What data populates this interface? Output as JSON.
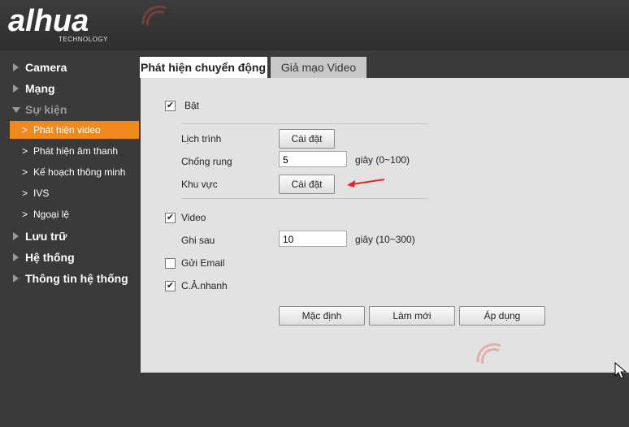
{
  "brand": {
    "logo": "alhua",
    "sub": "TECHNOLOGY"
  },
  "sidebar": {
    "camera": "Camera",
    "network": "Mạng",
    "event": "Sự kiện",
    "sub": {
      "motion": "Phát hiện video",
      "audio": "Phát hiện âm thanh",
      "smart_plan": "Kế hoạch thông minh",
      "ivs": "IVS",
      "exception": "Ngoại lệ"
    },
    "storage": "Lưu trữ",
    "system": "Hệ thống",
    "info": "Thông tin hệ thống"
  },
  "tabs": {
    "motion": "Phát hiện chuyển động",
    "tamper": "Giả mạo Video"
  },
  "form": {
    "enable": "Bật",
    "schedule": "Lịch trình",
    "schedule_btn": "Cài đặt",
    "anti_dither": "Chống rung",
    "anti_dither_value": "5",
    "anti_dither_unit": "giây (0~100)",
    "area": "Khu vực",
    "area_btn": "Cài đặt",
    "video": "Video",
    "post_record": "Ghi sau",
    "post_record_value": "10",
    "post_record_unit": "giây (10~300)",
    "send_email": "Gửi Email",
    "snapshot": "C.Ả.nhanh",
    "default_btn": "Mặc định",
    "refresh_btn": "Làm mới",
    "apply_btn": "Áp dụng"
  },
  "checks": {
    "enable": "✔",
    "video": "✔",
    "snapshot": "✔",
    "send_email": ""
  },
  "colors": {
    "accent": "#f08a1e",
    "arrow": "#e3262a"
  }
}
